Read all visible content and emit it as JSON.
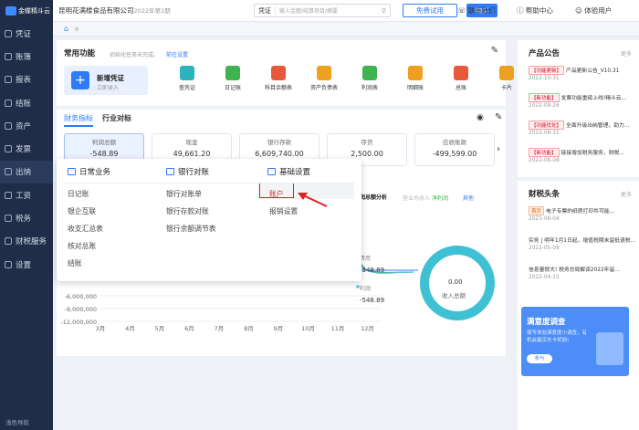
{
  "app": {
    "logo_text": "金蝶精斗云"
  },
  "sidebar": {
    "items": [
      {
        "label": "凭证",
        "icon": "voucher-icon"
      },
      {
        "label": "账簿",
        "icon": "ledger-icon"
      },
      {
        "label": "报表",
        "icon": "report-icon"
      },
      {
        "label": "结账",
        "icon": "close-icon"
      },
      {
        "label": "资产",
        "icon": "asset-icon"
      },
      {
        "label": "发票",
        "icon": "invoice-icon"
      },
      {
        "label": "出纳",
        "icon": "cashier-icon"
      },
      {
        "label": "工资",
        "icon": "salary-icon"
      },
      {
        "label": "税务",
        "icon": "tax-icon"
      },
      {
        "label": "财税服务",
        "icon": "service-icon"
      },
      {
        "label": "设置",
        "icon": "settings-icon"
      }
    ],
    "footer": "浅色导航"
  },
  "header": {
    "company": "昆明花满楼食品有限公司",
    "period": "2022年第2期",
    "search_type": "凭证",
    "search_placeholder": "输入金额/结算项目/摘要",
    "trial_button": "免费试用",
    "buy_button": "购买",
    "contact": "联系我们",
    "help": "帮助中心",
    "user": "体验用户"
  },
  "tabs": {
    "home_icon": "home-icon",
    "close_icon": "close-icon"
  },
  "common": {
    "title": "常用功能",
    "subtitle": "初始化任务未完成。",
    "link": "前往设置",
    "new_voucher": "新增凭证",
    "new_voucher_sub": "立即录入",
    "items": [
      {
        "label": "查凭证",
        "color": "#2bb3c0"
      },
      {
        "label": "日记账",
        "color": "#3fb34f"
      },
      {
        "label": "科目余额表",
        "color": "#e8593c"
      },
      {
        "label": "资产负债表",
        "color": "#f0a020"
      },
      {
        "label": "利润表",
        "color": "#3fb34f"
      },
      {
        "label": "明细账",
        "color": "#f0a020"
      },
      {
        "label": "总账",
        "color": "#e8593c"
      },
      {
        "label": "卡片",
        "color": "#f0a020"
      }
    ]
  },
  "finance": {
    "tab_active": "财务指标",
    "tab_other": "行业对标",
    "cards": [
      {
        "title": "利润总额",
        "value": "-548.89"
      },
      {
        "title": "现金",
        "value": "49,661.20"
      },
      {
        "title": "银行存款",
        "value": "6,609,740.00"
      },
      {
        "title": "存货",
        "value": "2,500.00"
      },
      {
        "title": "应收账款",
        "value": "-499,599.00"
      }
    ],
    "chart_title": "利润总额分析",
    "legend": [
      "营业总收入",
      "净利润",
      "费用",
      "其他"
    ],
    "donut_value": "0.00",
    "donut_label": "收入总额",
    "annot1_name": "费用",
    "annot1_val": "-548.89",
    "annot2_name": "利润",
    "annot2_val": "-548.89"
  },
  "chart_data": {
    "type": "line",
    "x": [
      "3月",
      "4月",
      "5月",
      "6月",
      "7月",
      "8月",
      "9月",
      "10月",
      "11月",
      "12月"
    ],
    "y_ticks": [
      "-6,000,000",
      "-9,000,000",
      "-12,000,000"
    ],
    "title": "利润总额分析"
  },
  "dropdown": {
    "col1_title": "日常业务",
    "col1_items": [
      "日记账",
      "银企互联",
      "收支汇总表",
      "核对总账",
      "结账"
    ],
    "col2_title": "银行对账",
    "col2_items": [
      "银行对账单",
      "银行存款对账",
      "银行余额调节表"
    ],
    "col3_title": "基础设置",
    "col3_items": [
      "账户",
      "报销设置"
    ]
  },
  "announcements": {
    "title": "产品公告",
    "more": "更多",
    "items": [
      {
        "tag": "【功能更新】",
        "text": "产品更新公告_V10.31",
        "date": "2022-10-31"
      },
      {
        "tag": "【新功能】",
        "text": "发票功能重磅上线!精斗云...",
        "date": "2022-09-26"
      },
      {
        "tag": "【功能优化】",
        "text": "全面升级出纳管理，助力...",
        "date": "2022-08-31"
      },
      {
        "tag": "【新功能】",
        "text": "链接增加税务服务，财税...",
        "date": "2022-08-08"
      }
    ]
  },
  "news": {
    "title": "财税头条",
    "more": "更多",
    "items": [
      {
        "tag": "首页",
        "text": "电子专票的纸质打印件可能...",
        "date": "2021-06-04"
      },
      {
        "tag": "",
        "text": "实务 | 明年1月1日起，增值税期末留抵退税...",
        "date": "2022-05-09"
      },
      {
        "tag": "",
        "text": "信息量很大! 税务总局解读2022年留...",
        "date": "2022-04-15"
      }
    ]
  },
  "banner": {
    "title": "满意度调查",
    "subtitle": "填写体验满意度小调查，有机会赢京东卡奖励!",
    "button": "参与"
  }
}
